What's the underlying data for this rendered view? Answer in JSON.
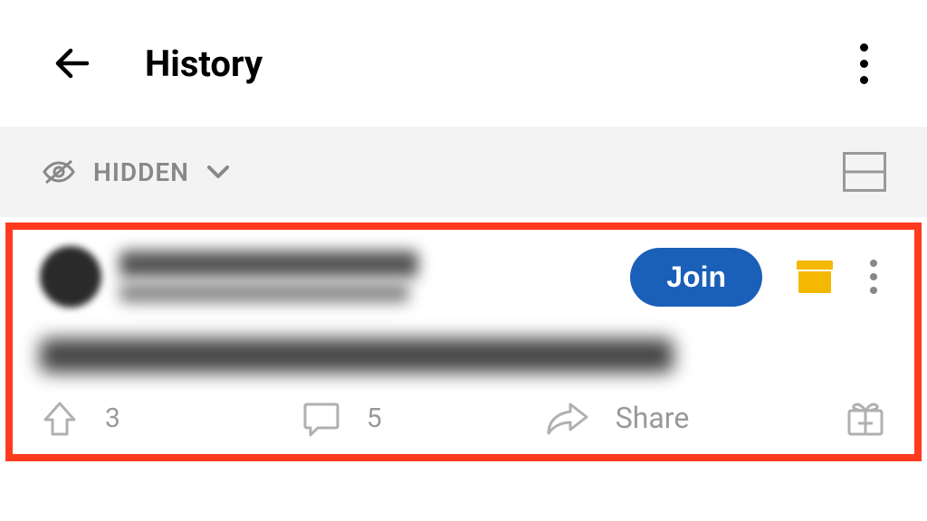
{
  "header": {
    "title": "History"
  },
  "filter": {
    "label": "HIDDEN"
  },
  "post": {
    "join_label": "Join",
    "upvotes": "3",
    "comments": "5",
    "share_label": "Share"
  }
}
